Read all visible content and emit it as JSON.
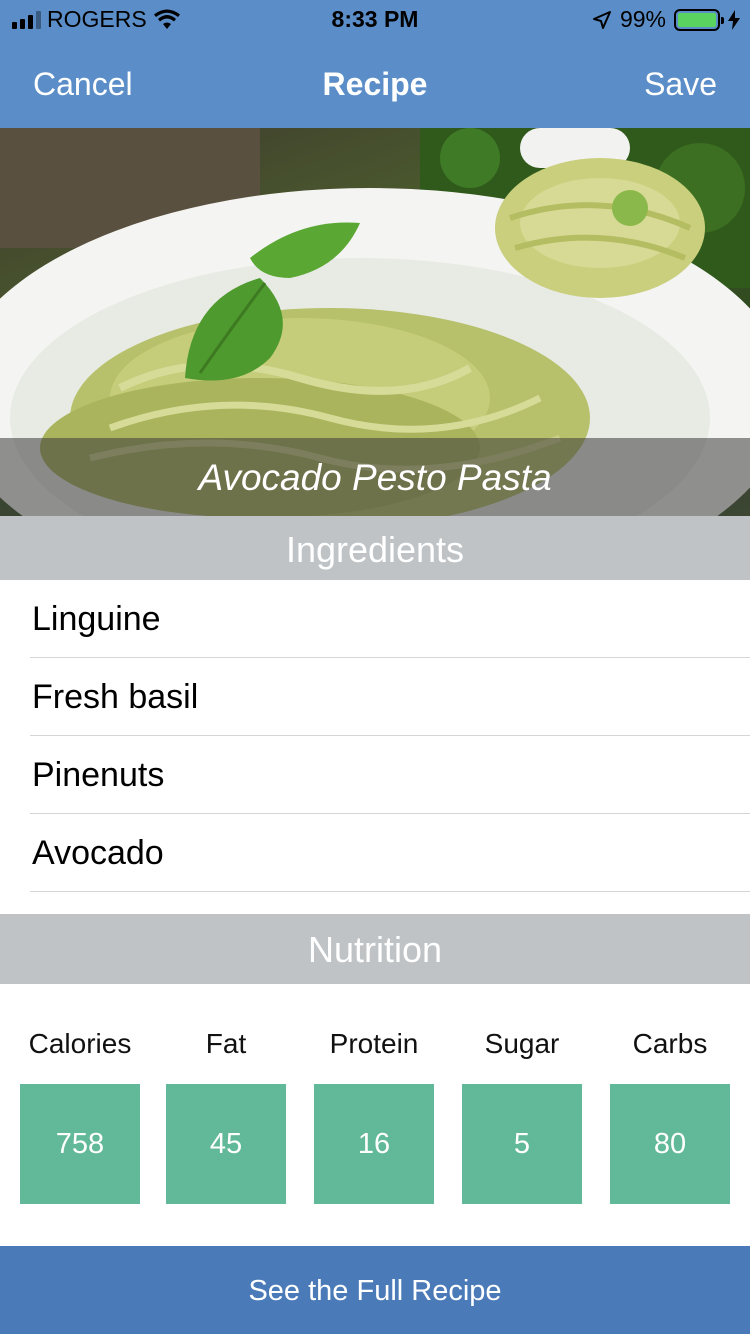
{
  "status_bar": {
    "carrier": "ROGERS",
    "time": "8:33 PM",
    "battery": "99%",
    "battery_level": 0.99,
    "icons": [
      "signal-icon",
      "wifi-icon",
      "location-arrow-icon",
      "battery-icon",
      "charging-bolt-icon"
    ]
  },
  "nav": {
    "cancel_label": "Cancel",
    "title": "Recipe",
    "save_label": "Save"
  },
  "recipe": {
    "name": "Avocado Pesto Pasta"
  },
  "ingredients": {
    "header": "Ingredients",
    "items": [
      "Linguine",
      "Fresh basil",
      "Pinenuts",
      "Avocado"
    ]
  },
  "nutrition": {
    "header": "Nutrition",
    "items": [
      {
        "label": "Calories",
        "value": "758"
      },
      {
        "label": "Fat",
        "value": "45"
      },
      {
        "label": "Protein",
        "value": "16"
      },
      {
        "label": "Sugar",
        "value": "5"
      },
      {
        "label": "Carbs",
        "value": "80"
      }
    ]
  },
  "footer": {
    "button_label": "See the Full Recipe"
  },
  "colors": {
    "nav_blue": "#5b8ec8",
    "footer_blue": "#4a7bb8",
    "section_gray": "#bfc3c5",
    "nutrition_green": "#62b99a"
  }
}
